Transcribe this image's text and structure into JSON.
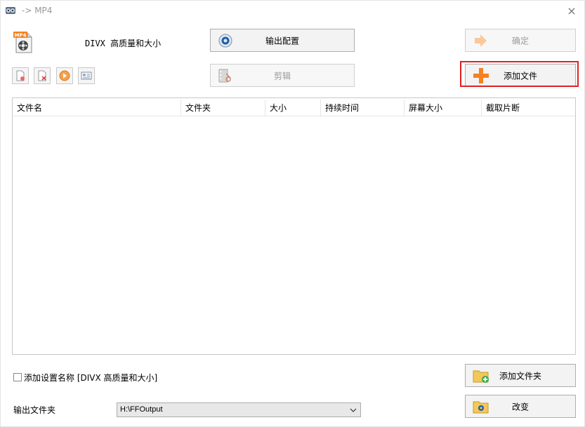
{
  "window": {
    "title": "-> MP4",
    "close": "×"
  },
  "format": {
    "name": "DIVX 高质量和大小",
    "badge": "MP4"
  },
  "buttons": {
    "output_config": "输出配置",
    "edit": "剪辑",
    "ok": "确定",
    "add_file": "添加文件",
    "add_folder": "添加文件夹",
    "change": "改变"
  },
  "file_list": {
    "columns": [
      "文件名",
      "文件夹",
      "大小",
      "持续时间",
      "屏幕大小",
      "截取片断"
    ],
    "rows": []
  },
  "options": {
    "add_setting_name_label": "添加设置名称 [DIVX 高质量和大小]",
    "add_setting_name_checked": false
  },
  "output": {
    "label": "输出文件夹",
    "folder": "H:\\FFOutput"
  },
  "colors": {
    "highlight": "#e02020",
    "accent_orange": "#f58220"
  }
}
